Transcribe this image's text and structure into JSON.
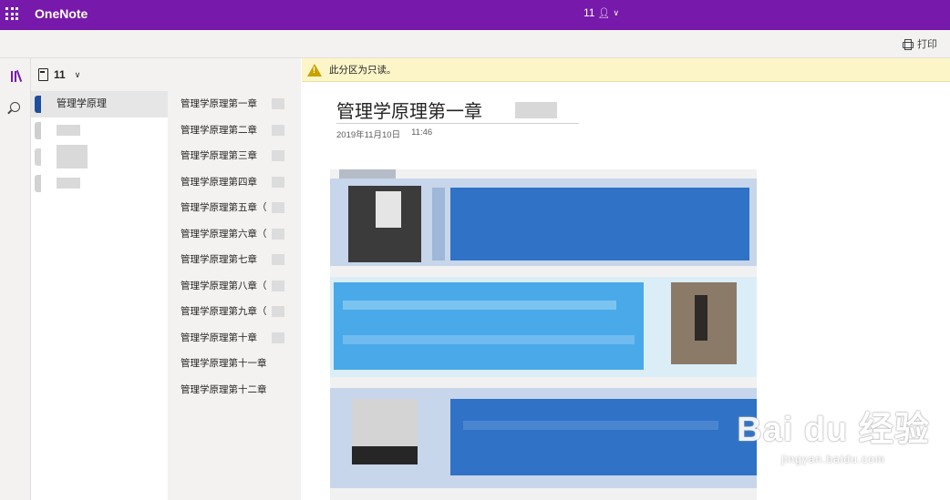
{
  "app": {
    "name": "OneNote"
  },
  "header": {
    "user_label": "11",
    "person_icon": "person-icon",
    "chevron_icon": "chevron-down-icon"
  },
  "ribbon": {
    "print_label": "打印"
  },
  "notebook": {
    "name": "11"
  },
  "sections": [
    {
      "label": "管理学原理",
      "color": "#1f4e9c",
      "selected": true
    },
    {
      "label": "",
      "color": "#cfcfcf",
      "selected": false
    },
    {
      "label": "",
      "color": "#d6d6d6",
      "selected": false
    },
    {
      "label": "",
      "color": "#d2d2d2",
      "selected": false
    }
  ],
  "pages": [
    "管理学原理第一章",
    "管理学原理第二章",
    "管理学原理第三章",
    "管理学原理第四章",
    "管理学原理第五章（",
    "管理学原理第六章（",
    "管理学原理第七章",
    "管理学原理第八章（",
    "管理学原理第九章（",
    "管理学原理第十章",
    "管理学原理第十一章",
    "管理学原理第十二章"
  ],
  "infobar": {
    "message": "此分区为只读。"
  },
  "page": {
    "title": "管理学原理第一章",
    "date": "2019年11月10日",
    "time": "11:46"
  },
  "watermark": {
    "brand": "Bai du 经验",
    "url": "jingyan.baidu.com"
  },
  "colors": {
    "accent": "#7719aa",
    "infobar": "#fcf5c8",
    "section_selected": "#1f4e9c"
  }
}
